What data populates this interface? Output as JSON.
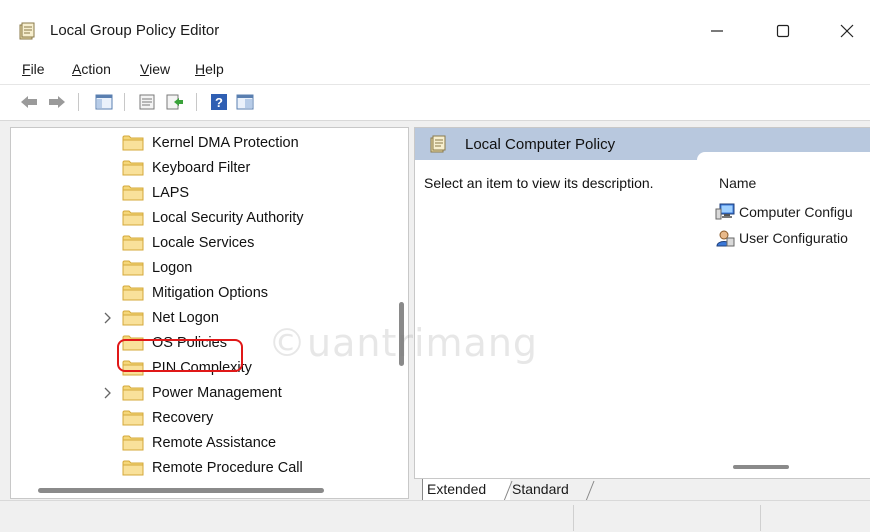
{
  "window": {
    "title": "Local Group Policy Editor",
    "controls": {
      "minimize": "—",
      "maximize": "☐",
      "close": "✕"
    }
  },
  "menu": [
    {
      "label": "File"
    },
    {
      "label": "Action"
    },
    {
      "label": "View"
    },
    {
      "label": "Help"
    }
  ],
  "toolbar": {
    "icons": [
      "back-arrow-icon",
      "forward-arrow-icon",
      "show-hide-tree-icon",
      "properties-icon",
      "export-list-icon",
      "help-icon",
      "extended-view-icon"
    ]
  },
  "tree": {
    "items": [
      {
        "label": "Kernel DMA Protection",
        "expandable": false
      },
      {
        "label": "Keyboard Filter",
        "expandable": false
      },
      {
        "label": "LAPS",
        "expandable": false
      },
      {
        "label": "Local Security Authority",
        "expandable": false
      },
      {
        "label": "Locale Services",
        "expandable": false
      },
      {
        "label": "Logon",
        "expandable": false
      },
      {
        "label": "Mitigation Options",
        "expandable": false
      },
      {
        "label": "Net Logon",
        "expandable": true
      },
      {
        "label": "OS Policies",
        "expandable": false,
        "highlighted": true
      },
      {
        "label": "PIN Complexity",
        "expandable": false
      },
      {
        "label": "Power Management",
        "expandable": true
      },
      {
        "label": "Recovery",
        "expandable": false
      },
      {
        "label": "Remote Assistance",
        "expandable": false
      },
      {
        "label": "Remote Procedure Call",
        "expandable": false
      }
    ],
    "highlight_color": "#e01818"
  },
  "right_pane": {
    "header": "Local Computer Policy",
    "description": "Select an item to view its description.",
    "column_name": "Name",
    "entries": [
      {
        "label": "Computer Configu",
        "icon": "computer-icon"
      },
      {
        "label": "User Configuratio",
        "icon": "user-icon"
      }
    ],
    "header_color": "#b8c8de"
  },
  "tabs": [
    {
      "label": "Extended",
      "active": true
    },
    {
      "label": "Standard",
      "active": false
    }
  ],
  "watermark": "©uantrimang"
}
